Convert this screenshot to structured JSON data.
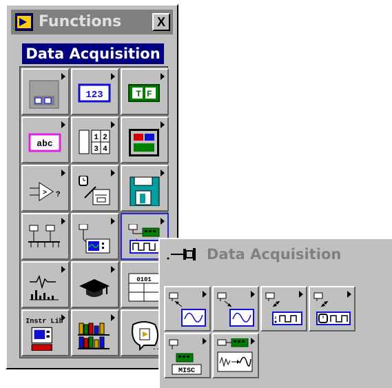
{
  "window": {
    "title": "Functions",
    "close_label": "X",
    "subtitle": "Data Acquisition"
  },
  "palette": {
    "items": [
      {
        "name": "cluster-palette-icon"
      },
      {
        "name": "numeric-palette-icon",
        "text": "123"
      },
      {
        "name": "boolean-palette-icon",
        "text": "T F"
      },
      {
        "name": "string-palette-icon",
        "text": "abc"
      },
      {
        "name": "array-palette-icon",
        "text": "1 2 3 4"
      },
      {
        "name": "cluster-bundle-palette-icon"
      },
      {
        "name": "comparison-palette-icon"
      },
      {
        "name": "time-dialog-palette-icon"
      },
      {
        "name": "file-io-palette-icon"
      },
      {
        "name": "communication-palette-icon"
      },
      {
        "name": "instrument-io-palette-icon"
      },
      {
        "name": "data-acquisition-palette-icon"
      },
      {
        "name": "analysis-palette-icon"
      },
      {
        "name": "tutorial-palette-icon"
      },
      {
        "name": "advanced-palette-icon"
      },
      {
        "name": "instrument-library-palette-icon",
        "text": "Instr Lib"
      },
      {
        "name": "user-libraries-palette-icon"
      },
      {
        "name": "select-vi-palette-icon"
      }
    ]
  },
  "subpalette": {
    "title": "Data Acquisition",
    "items": [
      {
        "name": "analog-input-icon"
      },
      {
        "name": "analog-output-icon"
      },
      {
        "name": "digital-io-icon"
      },
      {
        "name": "counter-icon"
      },
      {
        "name": "calibration-config-icon",
        "text": "MISC"
      },
      {
        "name": "signal-conditioning-icon"
      }
    ]
  },
  "colors": {
    "accent": "#000080",
    "face": "#c0c0c0",
    "selection": "#2a2ad0"
  }
}
